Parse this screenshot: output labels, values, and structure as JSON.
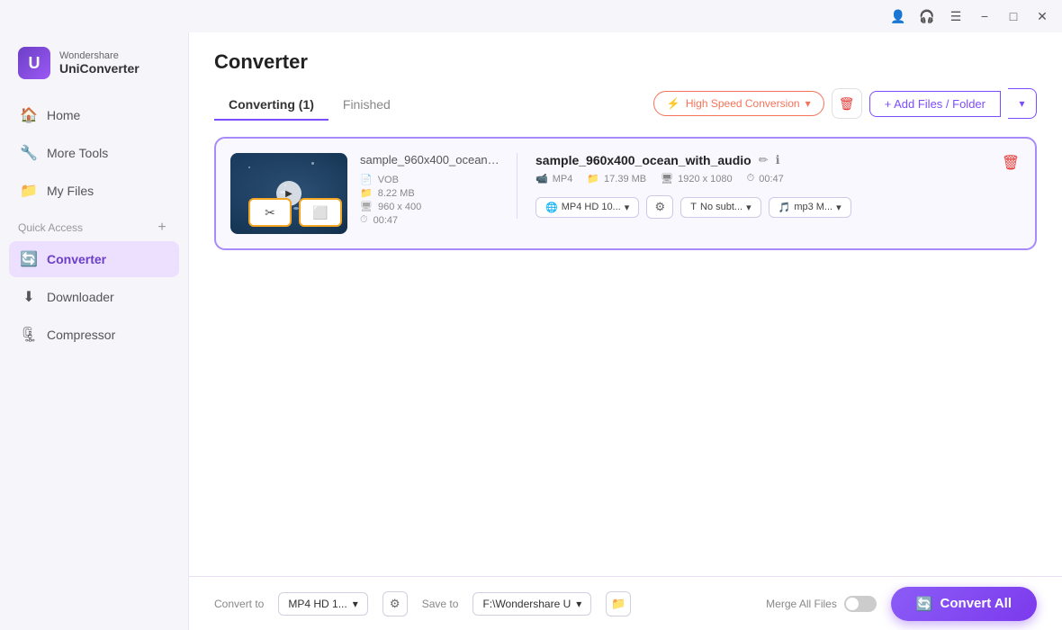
{
  "titlebar": {
    "profile_icon": "👤",
    "headphones_icon": "🎧",
    "menu_icon": "☰",
    "minimize_label": "−",
    "maximize_label": "□",
    "close_label": "✕"
  },
  "sidebar": {
    "logo_brand": "Wondershare",
    "logo_app": "UniConverter",
    "nav_items": [
      {
        "id": "home",
        "label": "Home",
        "icon": "🏠"
      },
      {
        "id": "more-tools",
        "label": "More Tools",
        "icon": "🔧"
      },
      {
        "id": "my-files",
        "label": "My Files",
        "icon": "📁"
      },
      {
        "id": "converter",
        "label": "Converter",
        "icon": "🔄"
      },
      {
        "id": "downloader",
        "label": "Downloader",
        "icon": "⬇"
      },
      {
        "id": "compressor",
        "label": "Compressor",
        "icon": "🗜"
      }
    ],
    "quick_access_label": "Quick Access"
  },
  "main": {
    "page_title": "Converter",
    "tabs": [
      {
        "id": "converting",
        "label": "Converting (1)",
        "active": true
      },
      {
        "id": "finished",
        "label": "Finished",
        "active": false
      }
    ],
    "toolbar": {
      "high_speed_label": "High Speed Conversion",
      "add_files_label": "+ Add Files / Folder"
    },
    "file_card": {
      "source_name": "sample_960x400_ocean_wit...",
      "source_format": "VOB",
      "source_size": "8.22 MB",
      "source_duration": "00:47",
      "source_resolution": "960 x 400",
      "output_name": "sample_960x400_ocean_with_audio",
      "output_format": "MP4",
      "output_size": "17.39 MB",
      "output_duration": "00:47",
      "output_resolution": "1920 x 1080",
      "quality_label": "MP4 HD 10...",
      "subtitle_label": "No subt...",
      "audio_label": "mp3 M...",
      "trim_icon": "✂",
      "crop_icon": "⬜"
    }
  },
  "bottom_bar": {
    "convert_to_label": "Convert to",
    "format_label": "MP4 HD 1...",
    "save_to_label": "Save to",
    "path_label": "F:\\Wondershare U",
    "merge_label": "Merge All Files",
    "convert_all_label": "Convert All"
  }
}
